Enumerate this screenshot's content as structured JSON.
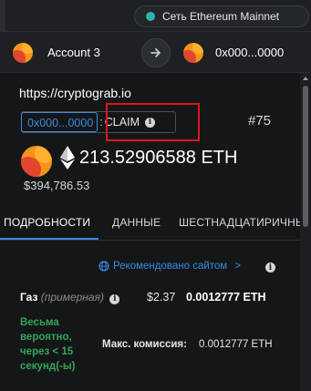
{
  "network": {
    "label": "Сеть Ethereum Mainnet",
    "dot_color": "#29b6af"
  },
  "account": {
    "from_name": "Account 3",
    "to_address": "0x000...0000",
    "arrow_icon": "arrow-right-icon"
  },
  "origin": "https://cryptograb.io",
  "contract": {
    "address": "0x000...0000",
    "separator": ":",
    "method": "CLAIM",
    "info_icon": "info-icon"
  },
  "nonce": "#75",
  "amount": {
    "value": "213.52906588 ETH",
    "fiat": "$394,786.53",
    "token_icon": "ethereum-icon"
  },
  "tabs": [
    {
      "label": "ПОДРОБНОСТИ",
      "active": true
    },
    {
      "label": "ДАННЫЕ",
      "active": false
    },
    {
      "label": "ШЕСТНАДЦАТИРИЧНЫЕ",
      "active": false
    }
  ],
  "recommended": {
    "label": "Рекомендовано сайтом",
    "chevron": ">",
    "icon": "globe-icon"
  },
  "gas": {
    "label": "Газ",
    "sublabel": "(примерная)",
    "fiat": "$2.37",
    "eth": "0.0012777 ETH"
  },
  "likely": "Весьма вероятно, через < 15 секунд(-ы)",
  "max_fee": {
    "label": "Макс. комиссия:",
    "value": "0.0012777 ETH"
  },
  "colors": {
    "accent": "#3d8ae0",
    "success": "#33a657",
    "highlight": "#e0141e",
    "background": "#141618"
  }
}
